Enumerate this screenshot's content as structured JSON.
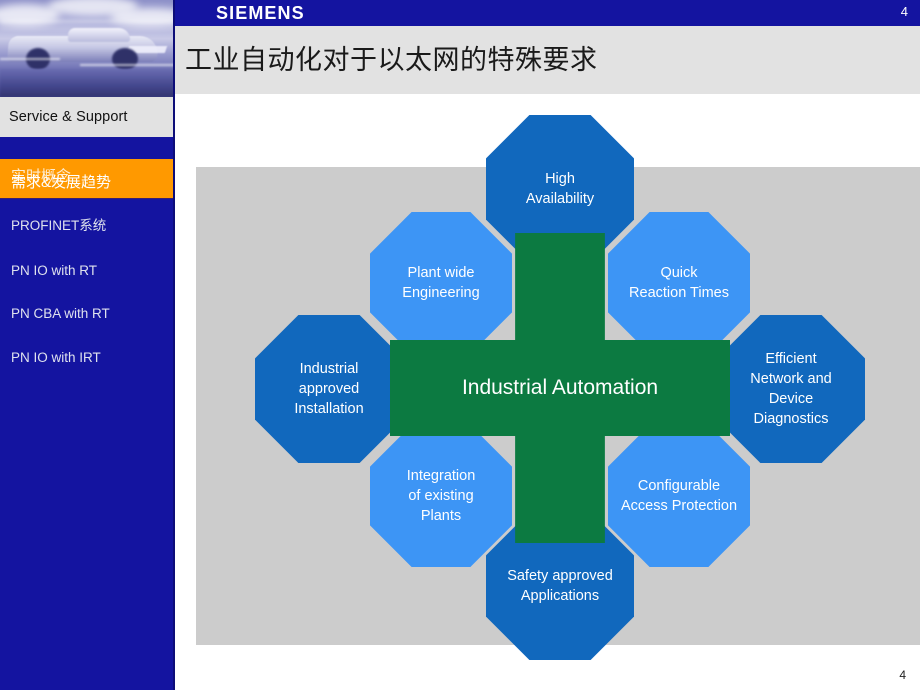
{
  "header": {
    "brand": "SIEMENS",
    "page_number": "4",
    "title": "工业自动化对于以太网的特殊要求"
  },
  "footer": {
    "page_number": "4"
  },
  "sidebar": {
    "brand_label": "Service & Support",
    "photo_alt": "racecar-image",
    "active_item": {
      "overlay_line": "实时概念",
      "label": "需求&发展趋势"
    },
    "items": [
      {
        "label": "PROFINET系统"
      },
      {
        "label": "PN IO with RT"
      },
      {
        "label": "PN CBA with RT"
      },
      {
        "label": "PN IO with IRT"
      }
    ]
  },
  "diagram": {
    "center_label": "Industrial Automation",
    "center_color": "#0c7a41",
    "dark_color": "#1168bd",
    "light_color": "#3d95f5",
    "panel_color": "#cccccc",
    "nodes": {
      "north": "High\nAvailability",
      "north_line1": "High",
      "north_line2": "Availability",
      "northwest_line1": "Plant wide",
      "northwest_line2": "Engineering",
      "northeast_line1": "Quick",
      "northeast_line2": "Reaction Times",
      "west_line1": "Industrial",
      "west_line2": "approved",
      "west_line3": "Installation",
      "east_line1": "Efficient",
      "east_line2": "Network and",
      "east_line3": "Device",
      "east_line4": "Diagnostics",
      "southwest_line1": "Integration",
      "southwest_line2": "of existing",
      "southwest_line3": "Plants",
      "southeast_line1": "Configurable",
      "southeast_line2": "Access Protection",
      "south_line1": "Safety approved",
      "south_line2": "Applications"
    }
  }
}
